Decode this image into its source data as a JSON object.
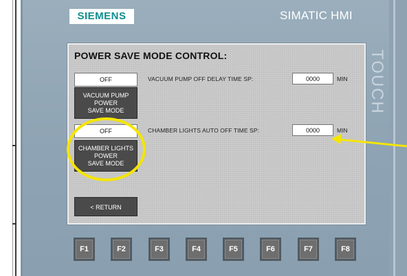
{
  "device": {
    "logo": "SIEMENS",
    "brand": "SIMATIC HMI",
    "side_label": "TOUCH"
  },
  "screen": {
    "title": "POWER SAVE MODE CONTROL:",
    "vacuum": {
      "status": "OFF",
      "button_lines": [
        "VACUUM PUMP",
        "POWER",
        "SAVE MODE"
      ],
      "label": "VACUUM PUMP OFF DELAY TIME SP:",
      "value": "0000",
      "unit": "MIN"
    },
    "chamber": {
      "status": "OFF",
      "button_lines": [
        "CHAMBER LIGHTS",
        "POWER",
        "SAVE MODE"
      ],
      "label": "CHAMBER LIGHTS AUTO OFF TIME SP:",
      "value": "0000",
      "unit": "MIN"
    },
    "return_label": "< RETURN"
  },
  "function_keys": [
    "F1",
    "F2",
    "F3",
    "F4",
    "F5",
    "F6",
    "F7",
    "F8"
  ],
  "colors": {
    "annotation": "#f5e500",
    "logo_text": "#0f8e8e",
    "button": "#4a4a4a"
  }
}
